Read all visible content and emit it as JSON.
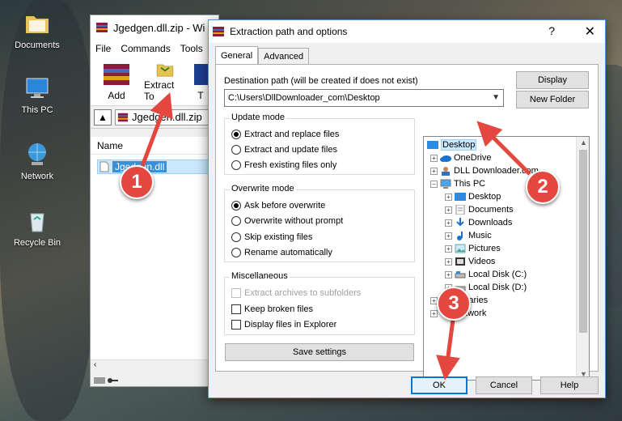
{
  "desktop": {
    "icons": [
      {
        "label": "Documents"
      },
      {
        "label": "This PC"
      },
      {
        "label": "Network"
      },
      {
        "label": "Recycle Bin"
      }
    ]
  },
  "winrar": {
    "title": "Jgedgen.dll.zip - Wi",
    "menu": [
      "File",
      "Commands",
      "Tools"
    ],
    "toolbar": [
      {
        "label": "Add",
        "icon": "add-archive-icon"
      },
      {
        "label": "Extract To",
        "icon": "extract-to-icon"
      },
      {
        "label": "T",
        "icon": "test-icon"
      }
    ],
    "path": "Jgedgen.dll.zip",
    "column_name": "Name",
    "file": "Jgedgen.dll"
  },
  "dialog": {
    "title": "Extraction path and options",
    "help_glyph": "?",
    "close_glyph": "✕",
    "tabs": [
      "General",
      "Advanced"
    ],
    "dest_label": "Destination path (will be created if does not exist)",
    "dest_value": "C:\\Users\\DllDownloader_com\\Desktop",
    "display_btn": "Display",
    "new_folder_btn": "New Folder",
    "update_mode": {
      "title": "Update mode",
      "options": [
        "Extract and replace files",
        "Extract and update files",
        "Fresh existing files only"
      ],
      "selected": 0
    },
    "overwrite_mode": {
      "title": "Overwrite mode",
      "options": [
        "Ask before overwrite",
        "Overwrite without prompt",
        "Skip existing files",
        "Rename automatically"
      ],
      "selected": 0
    },
    "misc": {
      "title": "Miscellaneous",
      "options": [
        "Extract archives to subfolders",
        "Keep broken files",
        "Display files in Explorer"
      ]
    },
    "save_settings_btn": "Save settings",
    "tree": [
      {
        "label": "Desktop",
        "level": 0,
        "selected": true,
        "icon": "desktop-folder-icon"
      },
      {
        "label": "OneDrive",
        "level": 1,
        "icon": "onedrive-icon"
      },
      {
        "label": "DLL Downloader.com",
        "level": 1,
        "icon": "user-folder-icon"
      },
      {
        "label": "This PC",
        "level": 1,
        "icon": "this-pc-icon"
      },
      {
        "label": "Desktop",
        "level": 2,
        "icon": "desktop-folder-icon"
      },
      {
        "label": "Documents",
        "level": 2,
        "icon": "documents-icon"
      },
      {
        "label": "Downloads",
        "level": 2,
        "icon": "downloads-icon"
      },
      {
        "label": "Music",
        "level": 2,
        "icon": "music-icon"
      },
      {
        "label": "Pictures",
        "level": 2,
        "icon": "pictures-icon"
      },
      {
        "label": "Videos",
        "level": 2,
        "icon": "videos-icon"
      },
      {
        "label": "Local Disk (C:)",
        "level": 2,
        "icon": "drive-icon"
      },
      {
        "label": "Local Disk (D:)",
        "level": 2,
        "icon": "drive-icon"
      },
      {
        "label": "Libraries",
        "level": 1,
        "icon": "libraries-icon"
      },
      {
        "label": "Network",
        "level": 1,
        "icon": "network-icon"
      }
    ],
    "ok_btn": "OK",
    "cancel_btn": "Cancel",
    "help_btn": "Help"
  },
  "markers": [
    "1",
    "2",
    "3"
  ]
}
